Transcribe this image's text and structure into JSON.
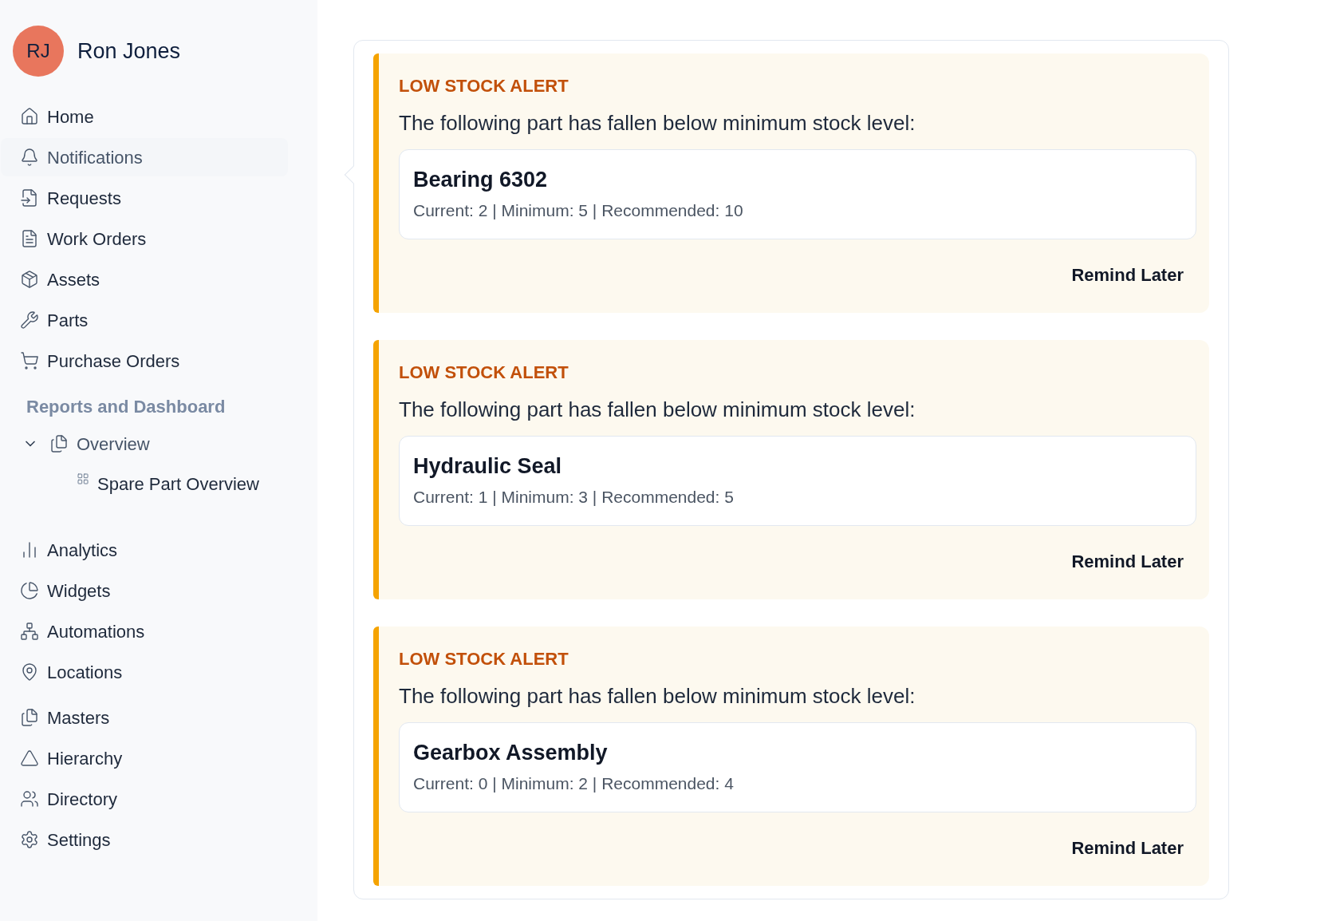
{
  "user": {
    "initials": "RJ",
    "name": "Ron Jones"
  },
  "sidebar": {
    "items": [
      {
        "kind": "link",
        "label": "Home",
        "selected": false
      },
      {
        "kind": "link",
        "label": "Notifications",
        "selected": true
      },
      {
        "kind": "link",
        "label": "Requests",
        "selected": false
      },
      {
        "kind": "link",
        "label": "Work Orders",
        "selected": false
      },
      {
        "kind": "link",
        "label": "Assets",
        "selected": false
      },
      {
        "kind": "link",
        "label": "Parts",
        "selected": false
      },
      {
        "kind": "link",
        "label": "Purchase Orders",
        "selected": false
      },
      {
        "kind": "section",
        "label": "Reports and Dashboard"
      },
      {
        "kind": "group",
        "label": "Overview",
        "expanded": true,
        "children": [
          {
            "label": "Spare Part Overview",
            "selected": false
          }
        ]
      },
      {
        "kind": "link",
        "label": "Analytics",
        "selected": false
      },
      {
        "kind": "link",
        "label": "Widgets",
        "selected": false
      },
      {
        "kind": "link",
        "label": "Automations",
        "selected": false
      },
      {
        "kind": "link",
        "label": "Locations",
        "selected": false
      },
      {
        "kind": "link",
        "label": "Masters",
        "selected": false
      },
      {
        "kind": "link",
        "label": "Hierarchy",
        "selected": false
      },
      {
        "kind": "link",
        "label": "Directory",
        "selected": false
      },
      {
        "kind": "link",
        "label": "Settings",
        "selected": false
      }
    ]
  },
  "alerts": [
    {
      "title": "LOW STOCK ALERT",
      "message": "The following part has fallen below minimum stock level:",
      "part": "Bearing 6302",
      "details": "Current: 2 | Minimum: 5 | Recommended: 10",
      "action": "Remind Later"
    },
    {
      "title": "LOW STOCK ALERT",
      "message": "The following part has fallen below minimum stock level:",
      "part": "Hydraulic Seal",
      "details": "Current: 1 | Minimum: 3 | Recommended: 5",
      "action": "Remind Later"
    },
    {
      "title": "LOW STOCK ALERT",
      "message": "The following part has fallen below minimum stock level:",
      "part": "Gearbox Assembly",
      "details": "Current: 0 | Minimum: 2 | Recommended: 4",
      "action": "Remind Later"
    }
  ]
}
